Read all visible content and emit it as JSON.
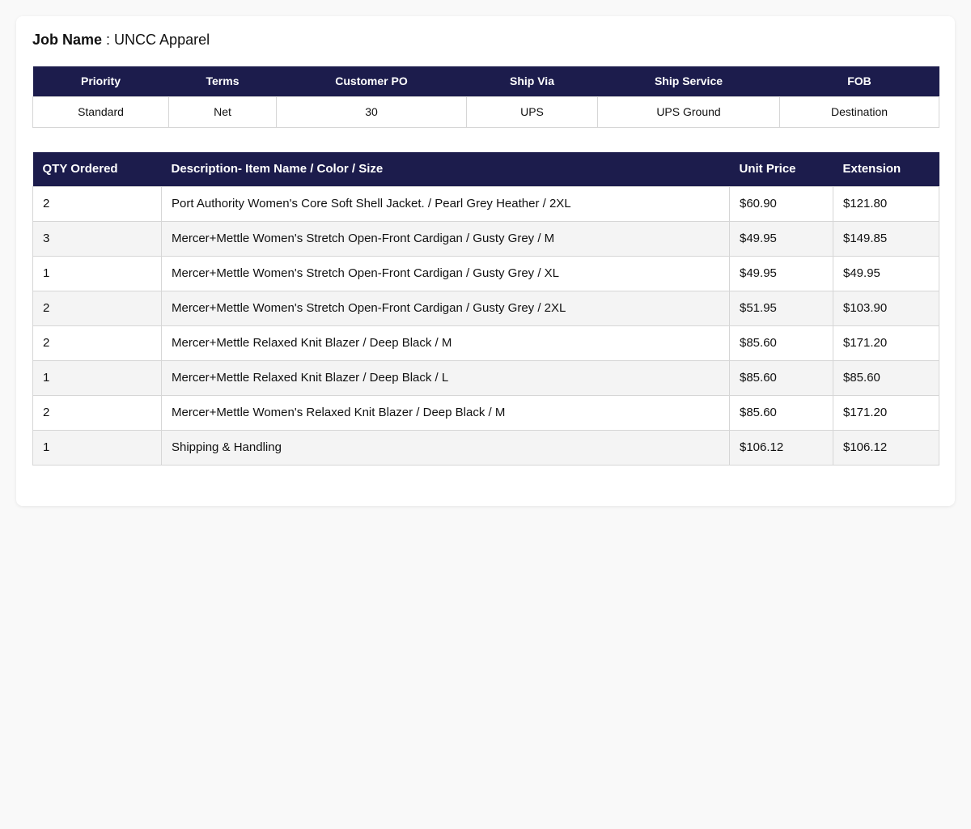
{
  "job": {
    "label": "Job Name",
    "separator": " : ",
    "value": "UNCC Apparel"
  },
  "order_info": {
    "headers": [
      "Priority",
      "Terms",
      "Customer PO",
      "Ship Via",
      "Ship Service",
      "FOB"
    ],
    "values": [
      "Standard",
      "Net",
      "30",
      "UPS",
      "UPS Ground",
      "Destination"
    ]
  },
  "items": {
    "headers": [
      "QTY Ordered",
      "Description- Item Name / Color / Size",
      "Unit Price",
      "Extension"
    ],
    "rows": [
      {
        "qty": "2",
        "description": "Port Authority Women's Core Soft Shell Jacket. / Pearl Grey Heather / 2XL",
        "unit_price": "$60.90",
        "extension": "$121.80"
      },
      {
        "qty": "3",
        "description": "Mercer+Mettle Women's Stretch Open-Front Cardigan / Gusty Grey / M",
        "unit_price": "$49.95",
        "extension": "$149.85"
      },
      {
        "qty": "1",
        "description": "Mercer+Mettle Women's Stretch Open-Front Cardigan / Gusty Grey / XL",
        "unit_price": "$49.95",
        "extension": "$49.95"
      },
      {
        "qty": "2",
        "description": "Mercer+Mettle Women's Stretch Open-Front Cardigan / Gusty Grey / 2XL",
        "unit_price": "$51.95",
        "extension": "$103.90"
      },
      {
        "qty": "2",
        "description": "Mercer+Mettle Relaxed Knit Blazer / Deep Black / M",
        "unit_price": "$85.60",
        "extension": "$171.20"
      },
      {
        "qty": "1",
        "description": "Mercer+Mettle Relaxed Knit Blazer / Deep Black / L",
        "unit_price": "$85.60",
        "extension": "$85.60"
      },
      {
        "qty": "2",
        "description": "Mercer+Mettle Women's Relaxed Knit Blazer / Deep Black / M",
        "unit_price": "$85.60",
        "extension": "$171.20"
      },
      {
        "qty": "1",
        "description": "Shipping & Handling",
        "unit_price": "$106.12",
        "extension": "$106.12"
      }
    ]
  },
  "colors": {
    "header_bg": "#1c1c4c",
    "header_text": "#ffffff",
    "alt_row_bg": "#f4f4f4",
    "page_bg": "#f9f9f9"
  }
}
